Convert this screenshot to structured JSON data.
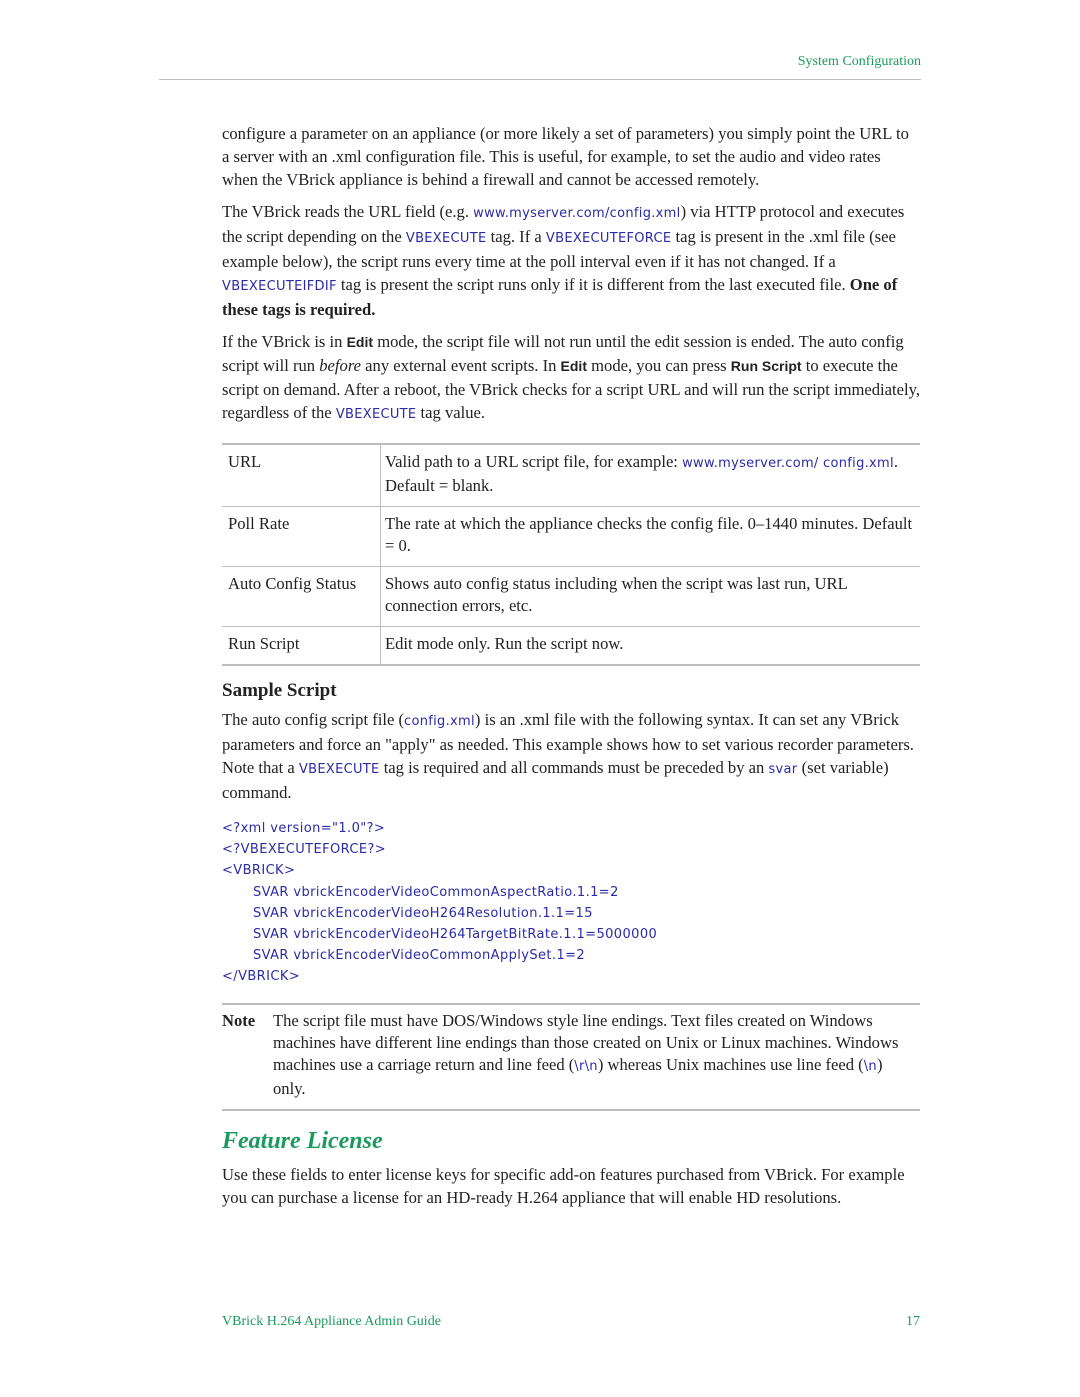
{
  "header": {
    "title": "System Configuration"
  },
  "intro": {
    "p1": "configure a parameter on an appliance (or more likely a set of parameters) you simply point the URL to a server with an .xml configuration file. This is useful, for example, to set the audio and video rates when the VBrick appliance is behind a firewall and cannot be accessed remotely.",
    "p2": {
      "t1": "The VBrick reads the URL field (e.g. ",
      "c1": "www.myserver.com/config.xml",
      "t2": ") via HTTP protocol and executes the script depending on the ",
      "c2": "VBEXECUTE",
      "t3": " tag. If a ",
      "c3": "VBEXECUTEFORCE",
      "t4": " tag is present in the .xml file (see example below), the script runs every time at the poll interval even if it has not changed. If a ",
      "c4": "VBEXECUTEIFDIF",
      "t5": " tag is present the script runs only if it is different from the last executed file. ",
      "bold": "One of these tags is required."
    },
    "p3": {
      "t1": "If the VBrick is in ",
      "ui1": "Edit",
      "t2": " mode, the script file will not run until the edit session is ended. The auto config script will run ",
      "em": "before",
      "t3": " any external event scripts. In ",
      "ui2": "Edit",
      "t4": " mode, you can press ",
      "ui3": "Run Script",
      "t5": " to execute the script on demand. After a reboot, the VBrick checks for a script URL and will run the script immediately, regardless of the ",
      "c1": "VBEXECUTE",
      "t6": " tag value."
    }
  },
  "params_table": [
    {
      "label": "URL",
      "desc_pre": "Valid path to a URL script file, for example: ",
      "desc_code": "www.myserver.com/ config.xml",
      "desc_post": ". Default = blank."
    },
    {
      "label": "Poll Rate",
      "desc": "The rate at which the appliance checks the config file. 0–1440 minutes. Default = 0."
    },
    {
      "label": "Auto Config Status",
      "desc": "Shows auto config status including when the script was last run, URL connection errors, etc."
    },
    {
      "label": "Run Script",
      "desc": "Edit mode only. Run the script now."
    }
  ],
  "sample_script": {
    "heading": "Sample Script",
    "p": {
      "t1": "The auto config script file (",
      "c1": "config.xml",
      "t2": ") is an .xml file with the following syntax. It can set any VBrick parameters and force an \"apply\" as needed. This example shows how to set various recorder parameters. Note that a ",
      "c2": "VBEXECUTE",
      "t3": " tag is required and all commands must be preceded by an ",
      "c3": "svar",
      "t4": " (set variable) command."
    },
    "code_lines": [
      "<?xml version=\"1.0\"?>",
      "<?VBEXECUTEFORCE?>",
      "<VBRICK>",
      "SVAR vbrickEncoderVideoCommonAspectRatio.1.1=2",
      "SVAR vbrickEncoderVideoH264Resolution.1.1=15",
      "SVAR vbrickEncoderVideoH264TargetBitRate.1.1=5000000",
      "SVAR vbrickEncoderVideoCommonApplySet.1=2",
      "</VBRICK>"
    ]
  },
  "note": {
    "label": "Note",
    "t1": "The script file must have DOS/Windows style line endings. Text files created on Windows machines have different line endings than those created on Unix or Linux machines. Windows machines use a carriage return and line feed (",
    "c1": "\\r\\n",
    "t2": ") whereas Unix machines use line feed (",
    "c2": "\\n",
    "t3": ") only."
  },
  "feature_license": {
    "heading": "Feature License",
    "p": "Use these fields to enter license keys for specific add-on features purchased from VBrick. For example you can purchase a license for an HD-ready H.264 appliance that will enable HD resolutions."
  },
  "footer": {
    "guide_title": "VBrick H.264 Appliance Admin Guide",
    "page_number": "17"
  }
}
